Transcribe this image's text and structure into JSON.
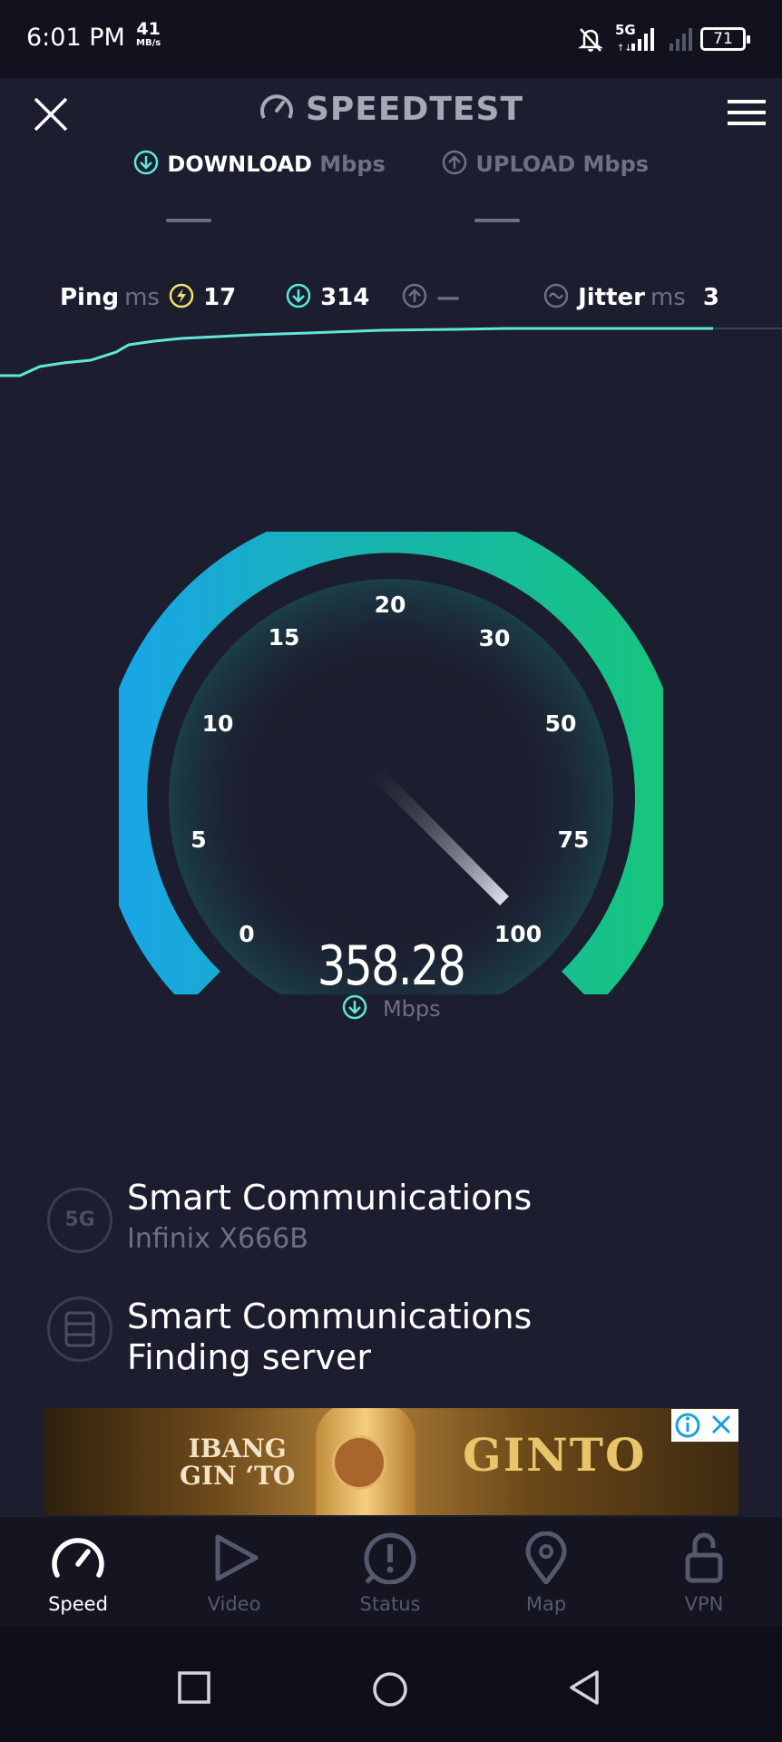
{
  "status_bar": {
    "time": "6:01 PM",
    "net_speed": "41",
    "net_speed_unit": "MB/s",
    "network": "5G",
    "battery": "71"
  },
  "header": {
    "title": "SPEEDTEST"
  },
  "tabs": {
    "download_label": "DOWNLOAD",
    "download_unit": "Mbps",
    "download_value": "—",
    "upload_label": "UPLOAD",
    "upload_unit": "Mbps",
    "upload_value": "—"
  },
  "metrics": {
    "ping_label": "Ping",
    "ping_unit": "ms",
    "ping_value": "17",
    "download_value": "314",
    "upload_value": "—",
    "jitter_label": "Jitter",
    "jitter_unit": "ms",
    "jitter_value": "3"
  },
  "gauge": {
    "ticks": [
      "0",
      "5",
      "10",
      "15",
      "20",
      "30",
      "50",
      "75",
      "100"
    ],
    "speed_value": "358.28",
    "speed_unit": "Mbps",
    "colors": {
      "start": "#19a6e8",
      "mid": "#17b4ab",
      "end": "#17c57f"
    }
  },
  "provider": {
    "network_badge": "5G",
    "name": "Smart Communications",
    "device": "Infinix X666B"
  },
  "server": {
    "name": "Smart Communications",
    "status": "Finding server"
  },
  "ad": {
    "left_text_1": "IBANG",
    "left_text_2": "GIN ‘TO",
    "brand": "GINTO"
  },
  "nav": {
    "items": [
      {
        "label": "Speed",
        "icon": "speed-gauge-icon"
      },
      {
        "label": "Video",
        "icon": "play-icon"
      },
      {
        "label": "Status",
        "icon": "alert-icon"
      },
      {
        "label": "Map",
        "icon": "map-pin-icon"
      },
      {
        "label": "VPN",
        "icon": "unlock-icon"
      }
    ]
  },
  "colors": {
    "background": "#1c1d2e",
    "accent": "#5ee8d8",
    "ping_accent": "#f4e26a",
    "muted": "#6d6f84"
  }
}
